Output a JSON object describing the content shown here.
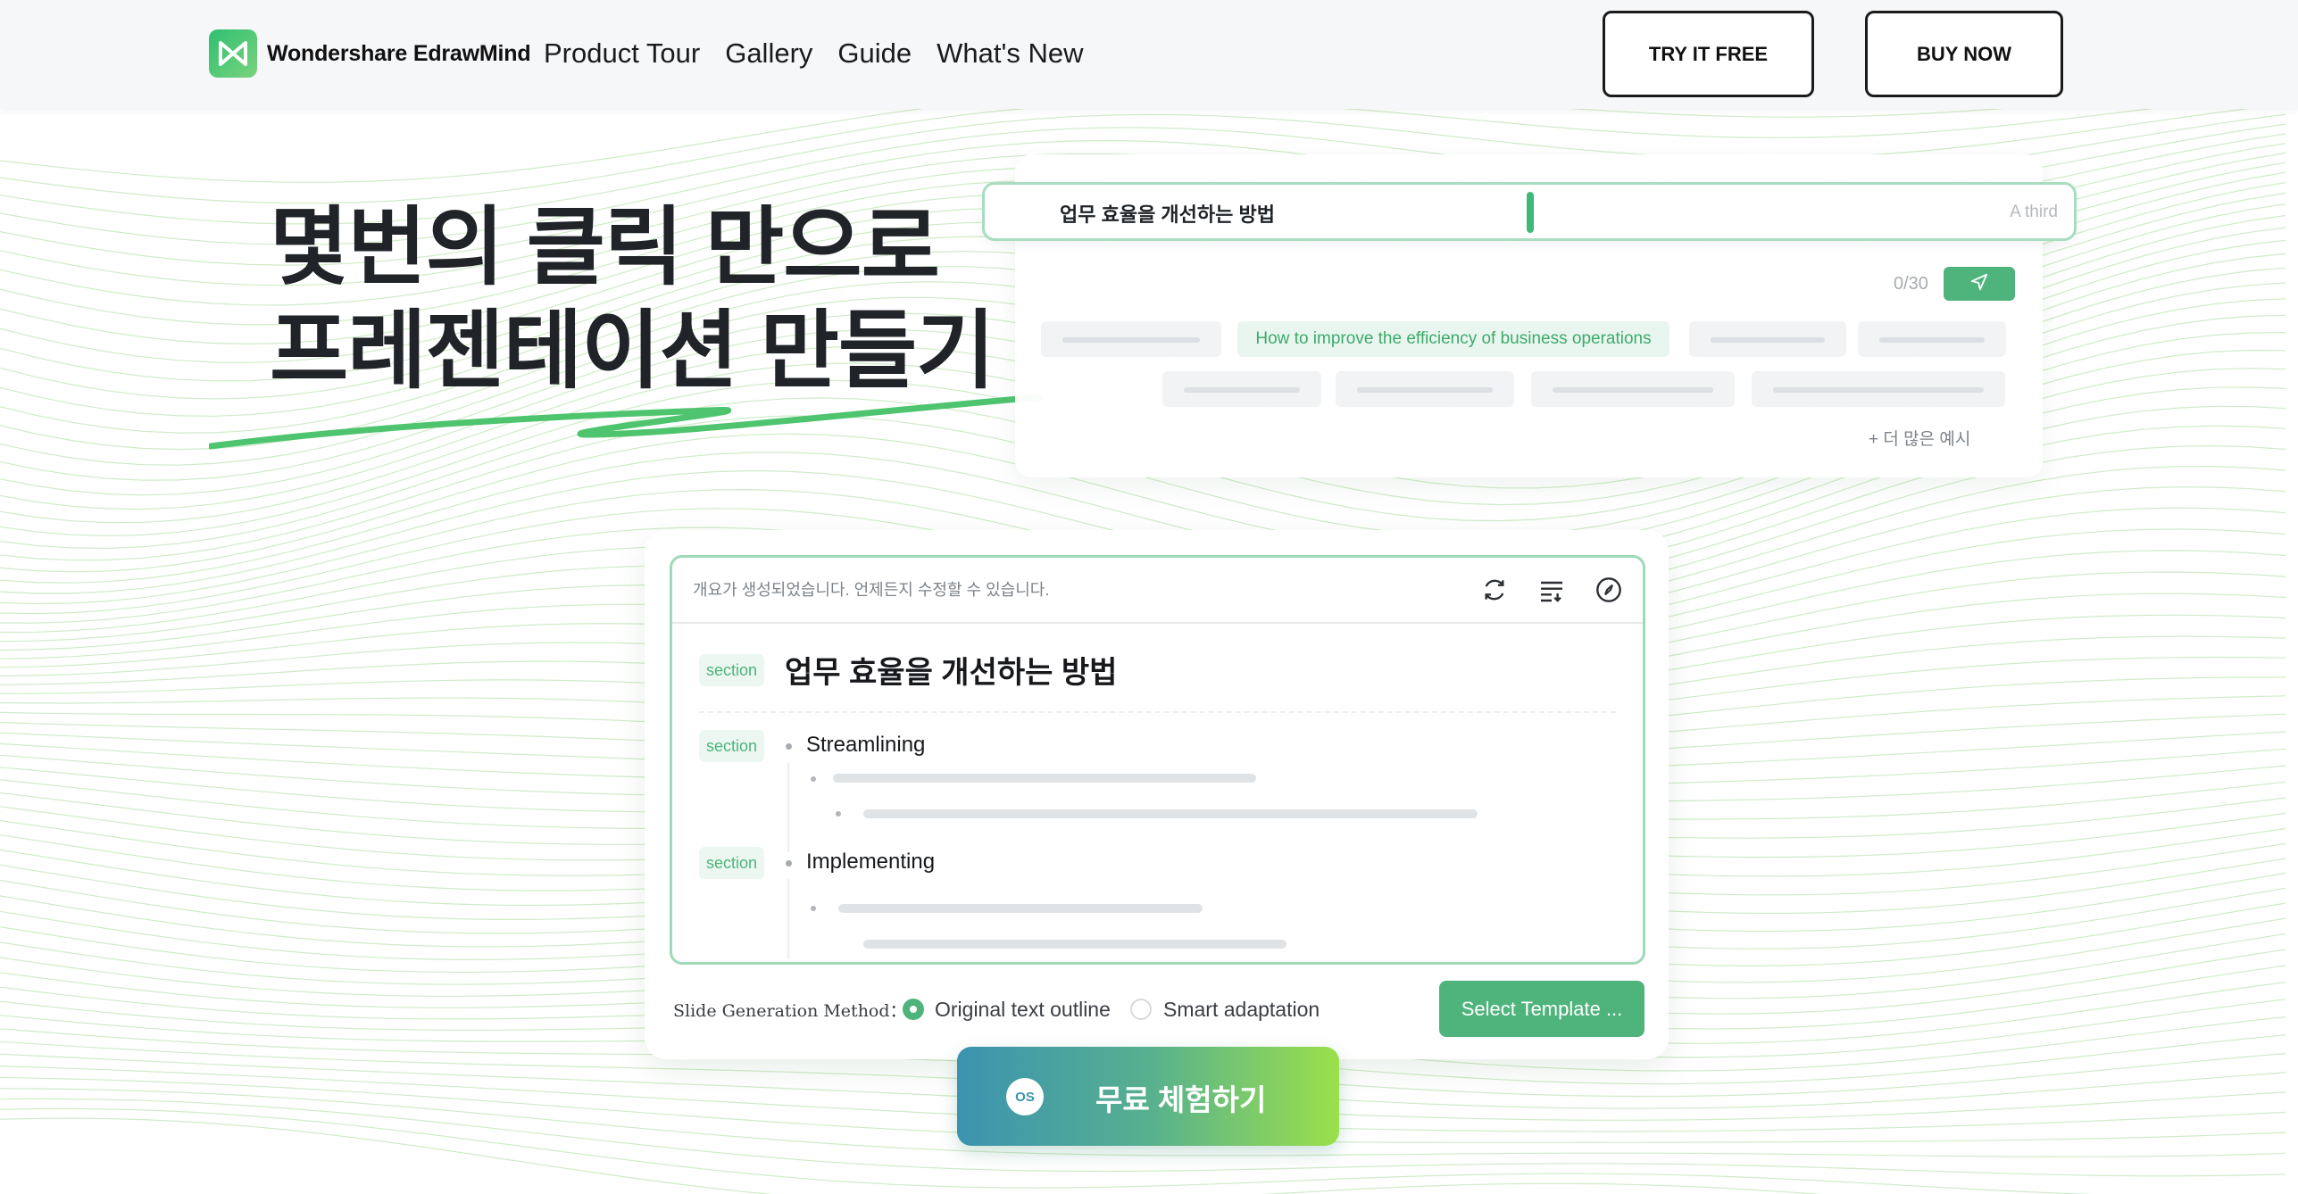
{
  "header": {
    "logo_text": "Wondershare EdrawMind",
    "nav": [
      "Product Tour",
      "Gallery",
      "Guide",
      "What's New"
    ],
    "try_button": "TRY IT FREE",
    "buy_button": "BUY NOW"
  },
  "hero": {
    "title_line1": "몇번의 클릭 만으로",
    "title_line2": "프레젠테이션 만들기"
  },
  "prompt_card": {
    "input_value": "업무 효율을 개선하는 방법",
    "input_hint": "A third",
    "counter": "0/30",
    "example_chip": "How to improve the efficiency of business operations",
    "more_examples": "+ 더 많은 예시"
  },
  "outline_card": {
    "notice": "개요가 생성되었습니다. 언제든지 수정할 수 있습니다.",
    "tag_label": "section",
    "title": "업무 효율을 개선하는 방법",
    "items": [
      "Streamlining",
      "Implementing"
    ],
    "method_label": "Slide Generation Method：",
    "option_original": "Original text outline",
    "option_smart": "Smart adaptation",
    "select_template": "Select Template ..."
  },
  "cta": {
    "os_label": "OS",
    "label": "무료 체험하기"
  },
  "colors": {
    "accent_green": "#4fb47c",
    "cta_start": "#3b93b0",
    "cta_end": "#9be04b"
  },
  "icons": [
    "logo-icon",
    "send-icon",
    "refresh-icon",
    "list-sort-icon",
    "compass-icon",
    "os-icon"
  ]
}
